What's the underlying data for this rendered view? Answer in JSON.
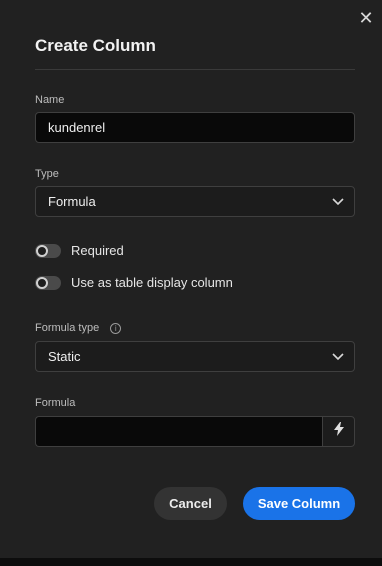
{
  "dialog": {
    "title": "Create Column",
    "close_icon": "close-icon"
  },
  "name_field": {
    "label": "Name",
    "value": "kundenrel"
  },
  "type_field": {
    "label": "Type",
    "value": "Formula"
  },
  "toggles": [
    {
      "label": "Required",
      "on": false
    },
    {
      "label": "Use as table display column",
      "on": false
    }
  ],
  "formula_type_field": {
    "label": "Formula type",
    "value": "Static"
  },
  "formula_field": {
    "label": "Formula",
    "value": ""
  },
  "buttons": {
    "cancel": "Cancel",
    "save": "Save Column"
  },
  "colors": {
    "primary": "#1a73e8",
    "background": "#212121"
  }
}
